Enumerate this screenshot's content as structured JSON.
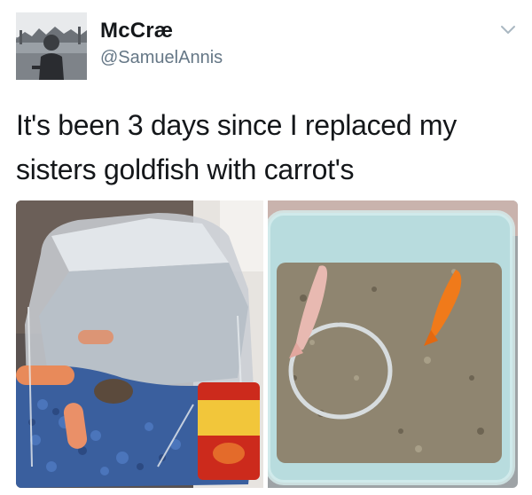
{
  "tweet": {
    "display_name": "McCræ",
    "handle": "@SamuelAnnis",
    "text_line_1": "It's been 3 days since I replaced my",
    "text_line_2": "sisters goldfish with carrot's"
  },
  "icons": {
    "caret": "chevron-down-icon"
  },
  "media": {
    "photos": [
      {
        "name": "carrots-in-fishbowl-photo",
        "depicts": "glass jar with blue gravel and baby carrots"
      },
      {
        "name": "goldfish-in-tub-photo",
        "depicts": "plastic tub with two goldfish"
      }
    ]
  },
  "colors": {
    "text_primary": "#14171a",
    "text_secondary": "#657786",
    "background": "#ffffff"
  }
}
